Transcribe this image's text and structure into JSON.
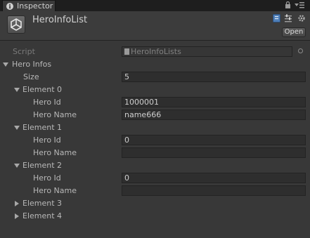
{
  "tab": {
    "title": "Inspector",
    "lock_icon": "lock-icon",
    "menu_icon": "menu-icon"
  },
  "header": {
    "object_title": "HeroInfoList",
    "icon": "unity-scriptable-object-icon",
    "open_label": "Open"
  },
  "script": {
    "label": "Script",
    "value": "HeroInfoLists"
  },
  "list": {
    "label": "Hero Infos",
    "size_label": "Size",
    "size_value": "5",
    "elements": [
      {
        "label": "Element 0",
        "hero_id_label": "Hero Id",
        "hero_id": "1000001",
        "hero_name_label": "Hero Name",
        "hero_name": "name666"
      },
      {
        "label": "Element 1",
        "hero_id_label": "Hero Id",
        "hero_id": "0",
        "hero_name_label": "Hero Name",
        "hero_name": ""
      },
      {
        "label": "Element 2",
        "hero_id_label": "Hero Id",
        "hero_id": "0",
        "hero_name_label": "Hero Name",
        "hero_name": ""
      },
      {
        "label": "Element 3"
      },
      {
        "label": "Element 4"
      }
    ]
  }
}
